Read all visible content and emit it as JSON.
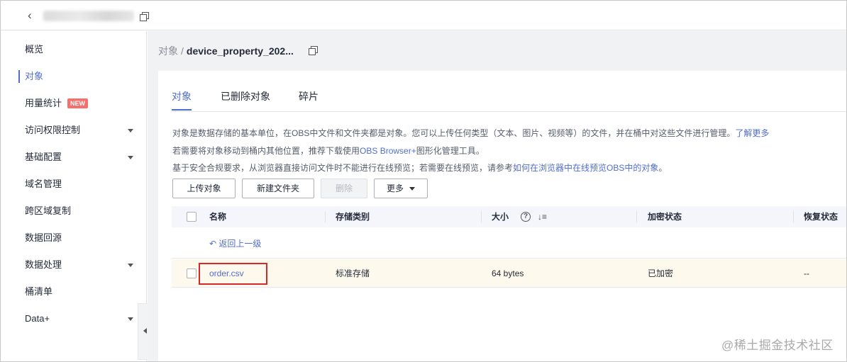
{
  "topbar": {
    "back_icon": "chevron-left-icon",
    "copy_icon": "copy-icon"
  },
  "sidebar": {
    "items": [
      {
        "label": "概览",
        "active": false,
        "expandable": false
      },
      {
        "label": "对象",
        "active": true,
        "expandable": false
      },
      {
        "label": "用量统计",
        "active": false,
        "expandable": false,
        "badge": "NEW"
      },
      {
        "label": "访问权限控制",
        "active": false,
        "expandable": true
      },
      {
        "label": "基础配置",
        "active": false,
        "expandable": true
      },
      {
        "label": "域名管理",
        "active": false,
        "expandable": false
      },
      {
        "label": "跨区域复制",
        "active": false,
        "expandable": false
      },
      {
        "label": "数据回源",
        "active": false,
        "expandable": false
      },
      {
        "label": "数据处理",
        "active": false,
        "expandable": true
      },
      {
        "label": "桶清单",
        "active": false,
        "expandable": false
      },
      {
        "label": "Data+",
        "active": false,
        "expandable": true
      }
    ]
  },
  "breadcrumb": {
    "root": "对象",
    "separator": "/",
    "current": "device_property_202..."
  },
  "tabs": [
    {
      "label": "对象",
      "active": true
    },
    {
      "label": "已删除对象",
      "active": false
    },
    {
      "label": "碎片",
      "active": false
    }
  ],
  "info": {
    "line1_text": "对象是数据存储的基本单位，在OBS中文件和文件夹都是对象。您可以上传任何类型（文本、图片、视频等）的文件，并在桶中对这些文件进行管理。",
    "line1_link": "了解更多",
    "line2_text": "若需要将对象移动到桶内其他位置，推荐下载使用",
    "line2_link": "OBS Browser+",
    "line2_suffix": "图形化管理工具。",
    "line3_text": "基于安全合规要求，从浏览器直接访问文件时不能进行在线预览；若需要在线预览，请参考",
    "line3_link": "如何在浏览器中在线预览OBS中的对象",
    "line3_suffix": "。"
  },
  "toolbar": {
    "upload": "上传对象",
    "new_folder": "新建文件夹",
    "delete": "删除",
    "more": "更多"
  },
  "table": {
    "headers": {
      "name": "名称",
      "storage_class": "存储类别",
      "size": "大小",
      "encryption": "加密状态",
      "restore": "恢复状态"
    },
    "back_link": "返回上一级",
    "rows": [
      {
        "name": "order.csv",
        "storage_class": "标准存储",
        "size": "64 bytes",
        "encryption": "已加密",
        "restore": "--"
      }
    ]
  },
  "watermark": "@稀土掘金技术社区",
  "colors": {
    "accent": "#526ecc",
    "badge": "#f66f6a",
    "highlight_border": "#d9272e",
    "row_highlight": "#fdf9ec"
  }
}
